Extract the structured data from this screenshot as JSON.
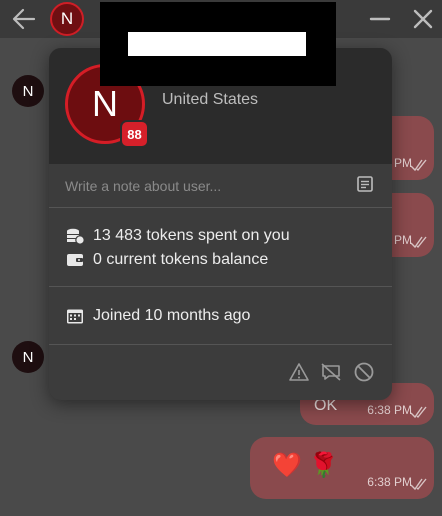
{
  "header": {
    "avatar_letter": "N",
    "back_icon": "arrow-left-icon",
    "minimize_icon": "minimize-icon",
    "close_icon": "close-icon"
  },
  "profile": {
    "avatar_letter": "N",
    "level": "88",
    "country": "United States",
    "note_placeholder": "Write a note about user...",
    "tokens_spent": "13 483 tokens spent on you",
    "tokens_balance": "0 current tokens balance",
    "joined": "Joined 10 months ago",
    "actions": [
      "report-icon",
      "block-messages-icon",
      "ban-icon"
    ]
  },
  "chat": {
    "avatar_letter": "N",
    "messages": [
      {
        "text": "",
        "time": "6:38 PM"
      },
      {
        "text": "",
        "time": "6:38 PM"
      },
      {
        "text": "OK",
        "time": "6:38 PM"
      },
      {
        "text": "❤️ 🌹",
        "time": "6:38 PM"
      }
    ]
  },
  "colors": {
    "accent": "#d51d26",
    "bubble": "#8a4a4d",
    "card": "#3c3c3c",
    "background": "#4a4a4a"
  }
}
